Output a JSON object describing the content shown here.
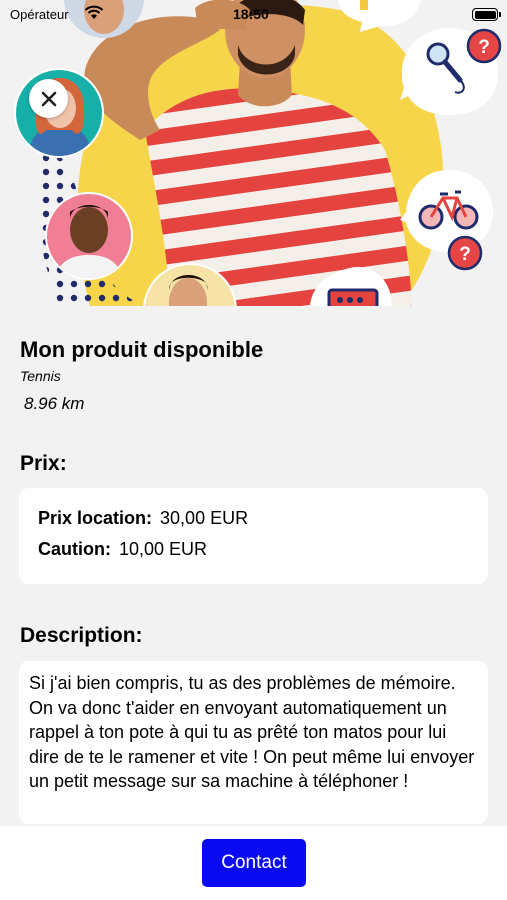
{
  "status_bar": {
    "carrier": "Opérateur",
    "time": "18:50"
  },
  "product": {
    "title": "Mon produit disponible",
    "category": "Tennis",
    "distance": "8.96 km"
  },
  "pricing": {
    "heading": "Prix:",
    "rental_label": "Prix location:",
    "rental_value": "30,00 EUR",
    "deposit_label": "Caution:",
    "deposit_value": "10,00 EUR"
  },
  "description": {
    "heading": "Description:",
    "text": "Si j'ai bien compris, tu as des problèmes de mémoire. On va donc t'aider en envoyant automatiquement un rappel à ton pote à qui tu as prêté ton matos pour lui dire de te le ramener et vite ! On peut même lui envoyer un petit message sur sa machine à téléphoner !"
  },
  "actions": {
    "contact_label": "Contact"
  },
  "colors": {
    "accent": "#0a0af2",
    "hero_yellow": "#f7d54a",
    "question_badge": "#e64545",
    "background": "#f2f2f2"
  },
  "icons": {
    "close": "close-icon",
    "question": "question-icon",
    "microphone": "microphone-icon",
    "bicycle": "bicycle-icon",
    "radio": "radio-icon"
  }
}
